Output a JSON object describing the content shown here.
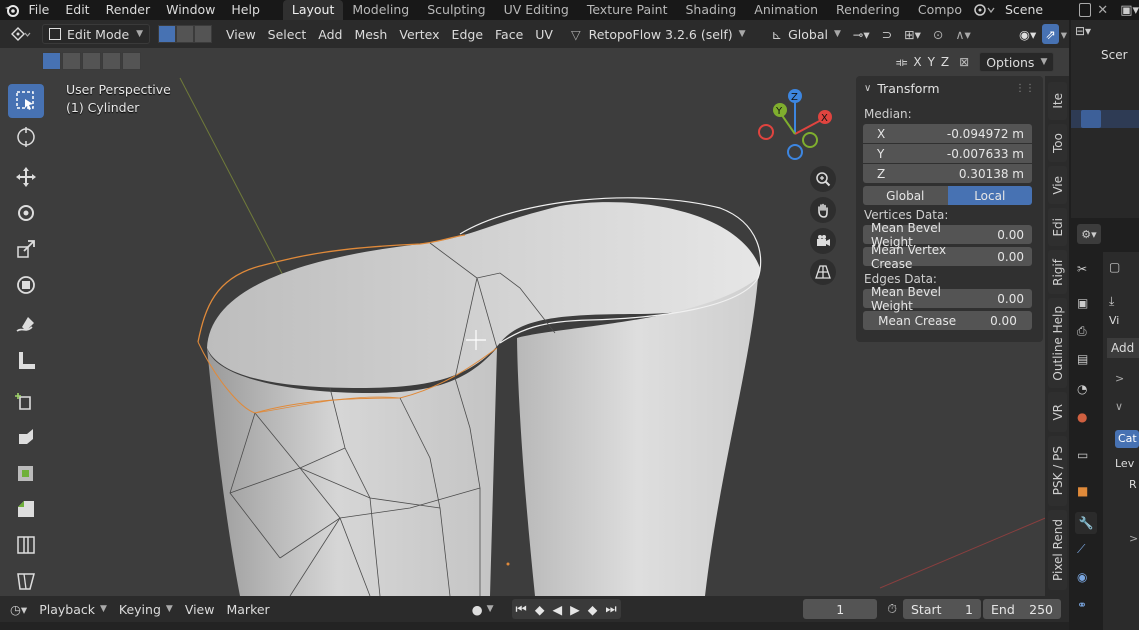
{
  "menubar": {
    "items": [
      "File",
      "Edit",
      "Render",
      "Window",
      "Help"
    ],
    "workspaces": [
      "Layout",
      "Modeling",
      "Sculpting",
      "UV Editing",
      "Texture Paint",
      "Shading",
      "Animation",
      "Rendering",
      "Compo"
    ],
    "active_workspace": "Layout",
    "scene_label": "Scene"
  },
  "header": {
    "mode": "Edit Mode",
    "menus": [
      "View",
      "Select",
      "Add",
      "Mesh",
      "Vertex",
      "Edge",
      "Face",
      "UV"
    ],
    "addon": "RetopoFlow 3.2.6 (self)",
    "orientation": "Global",
    "axes": [
      "X",
      "Y",
      "Z"
    ],
    "options": "Options"
  },
  "viewport": {
    "perspective": "User Perspective",
    "object": "(1) Cylinder",
    "gizmo_axes": [
      "X",
      "Y",
      "Z"
    ]
  },
  "npanel": {
    "title": "Transform",
    "median_label": "Median:",
    "fields": [
      {
        "label": "X",
        "value": "-0.094972 m"
      },
      {
        "label": "Y",
        "value": "-0.007633 m"
      },
      {
        "label": "Z",
        "value": "0.30138 m"
      }
    ],
    "space_options": [
      "Global",
      "Local"
    ],
    "active_space": "Local",
    "vertices_label": "Vertices Data:",
    "vertex_fields": [
      {
        "label": "Mean Bevel Weight",
        "value": "0.00"
      },
      {
        "label": "Mean Vertex Crease",
        "value": "0.00"
      }
    ],
    "edges_label": "Edges Data:",
    "edge_fields": [
      {
        "label": "Mean Bevel Weight",
        "value": "0.00"
      },
      {
        "label": "Mean Crease",
        "value": "0.00"
      }
    ]
  },
  "side_tabs": [
    "Ite",
    "Too",
    "Vie",
    "Edi",
    "Rigif",
    "Outline Help",
    "VR",
    "PSK / PS",
    "Pixel Rend"
  ],
  "outliner": {
    "scene_label": "Scer",
    "add_label": "Add",
    "props_labels": [
      "Vi",
      "Cat",
      "Lev",
      "R"
    ]
  },
  "timeline": {
    "items": [
      "Playback",
      "Keying",
      "View",
      "Marker"
    ],
    "current_frame": "1",
    "start_label": "Start",
    "start_value": "1",
    "end_label": "End",
    "end_value": "250"
  },
  "colors": {
    "accent": "#4772b3",
    "axis_x": "#e0443f",
    "axis_y": "#7fae2e",
    "axis_z": "#3d86e0",
    "selection": "#e08a3a"
  }
}
